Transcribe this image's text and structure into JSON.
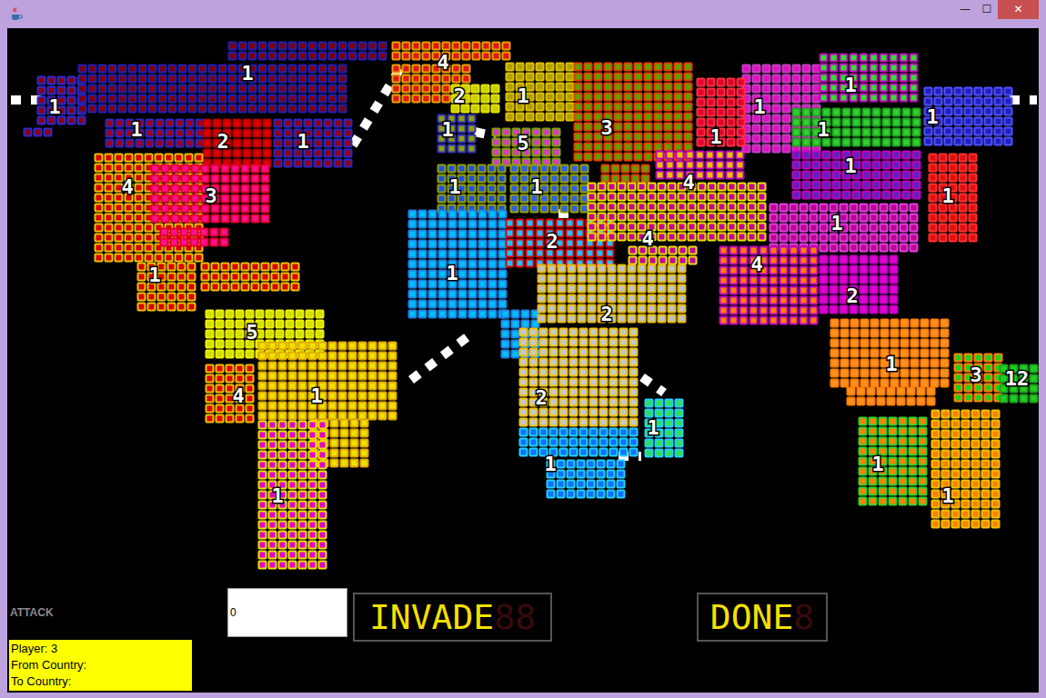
{
  "window": {
    "title": "",
    "controls": [
      "—",
      "☐",
      "✕"
    ]
  },
  "map": {
    "territories": [
      {
        "armies": "1",
        "color": "#8a0010",
        "border": "#2b2bd0"
      },
      {
        "armies": "1",
        "color": "#7a0010",
        "border": "#2020b0"
      },
      {
        "armies": "4",
        "color": "#e01818",
        "border": "#e8a000"
      },
      {
        "armies": "1",
        "color": "#a00018",
        "border": "#2828c0"
      },
      {
        "armies": "2",
        "color": "#e00000",
        "border": "#b00000"
      },
      {
        "armies": "1",
        "color": "#900018",
        "border": "#2828c0"
      },
      {
        "armies": "4",
        "color": "#d80000",
        "border": "#f0c000"
      },
      {
        "armies": "3",
        "color": "#ff1090",
        "border": "#e00030"
      },
      {
        "armies": "1",
        "color": "#d80000",
        "border": "#f0c000"
      },
      {
        "armies": "5",
        "color": "#d0e000",
        "border": "#f0f000"
      },
      {
        "armies": "4",
        "color": "#e00000",
        "border": "#f0c000"
      },
      {
        "armies": "1",
        "color": "#f0e000",
        "border": "#e0a800"
      },
      {
        "armies": "1",
        "color": "#e000d0",
        "border": "#f0e000"
      },
      {
        "armies": "1",
        "color": "#90a000",
        "border": "#3030c0"
      },
      {
        "armies": "2",
        "color": "#c8d000",
        "border": "#e0e000"
      },
      {
        "armies": "1",
        "color": "#b0a000",
        "border": "#e0c000"
      },
      {
        "armies": "5",
        "color": "#d040c0",
        "border": "#80a000"
      },
      {
        "armies": "1",
        "color": "#2050e0",
        "border": "#90a000"
      },
      {
        "armies": "1",
        "color": "#3060e0",
        "border": "#90a000"
      },
      {
        "armies": "3",
        "color": "#60a000",
        "border": "#e04000"
      },
      {
        "armies": "1",
        "color": "#00c0ff",
        "border": "#2080e0"
      },
      {
        "armies": "2",
        "color": "#20c0ff",
        "border": "#e00000"
      },
      {
        "armies": "4",
        "color": "#c000a0",
        "border": "#f0e000"
      },
      {
        "armies": "2",
        "color": "#b8c4d4",
        "border": "#e8b800"
      },
      {
        "armies": "2",
        "color": "#c0c8d8",
        "border": "#f0c000"
      },
      {
        "armies": "1",
        "color": "#1070ff",
        "border": "#20d0ff"
      },
      {
        "armies": "1",
        "color": "#30e050",
        "border": "#20d0ff"
      },
      {
        "armies": "4",
        "color": "#e8c000",
        "border": "#c000c0"
      },
      {
        "armies": "1",
        "color": "#e010c0",
        "border": "#c040c0"
      },
      {
        "armies": "1",
        "color": "#e00030",
        "border": "#ff3040"
      },
      {
        "armies": "1",
        "color": "#30e030",
        "border": "#c000c0"
      },
      {
        "armies": "1",
        "color": "#30d030",
        "border": "#20a020"
      },
      {
        "armies": "1",
        "color": "#2020c0",
        "border": "#5050ff"
      },
      {
        "armies": "1",
        "color": "#6020c0",
        "border": "#c000c0"
      },
      {
        "armies": "1",
        "color": "#e01010",
        "border": "#ff3030"
      },
      {
        "armies": "1",
        "color": "#c00090",
        "border": "#e040e0"
      },
      {
        "armies": "4",
        "color": "#ff8000",
        "border": "#c000c0"
      },
      {
        "armies": "2",
        "color": "#e000d0",
        "border": "#c000c0"
      },
      {
        "armies": "1",
        "color": "#ff9020",
        "border": "#ff8000"
      },
      {
        "armies": "3",
        "color": "#20d020",
        "border": "#ff8000"
      },
      {
        "armies": "12",
        "color": "#20d020",
        "border": "#20a020"
      },
      {
        "armies": "1",
        "color": "#ff8000",
        "border": "#30d030"
      },
      {
        "armies": "1",
        "color": "#ff8000",
        "border": "#f0c000"
      }
    ]
  },
  "mode": "ATTACK",
  "armies_field": {
    "value": "0"
  },
  "buttons": [
    {
      "label": "INVADE",
      "ghost": "88"
    },
    {
      "label": "DONE",
      "ghost": "8"
    }
  ],
  "info": {
    "lines": [
      "Player: 3",
      "From Country:",
      "To Country:"
    ]
  }
}
